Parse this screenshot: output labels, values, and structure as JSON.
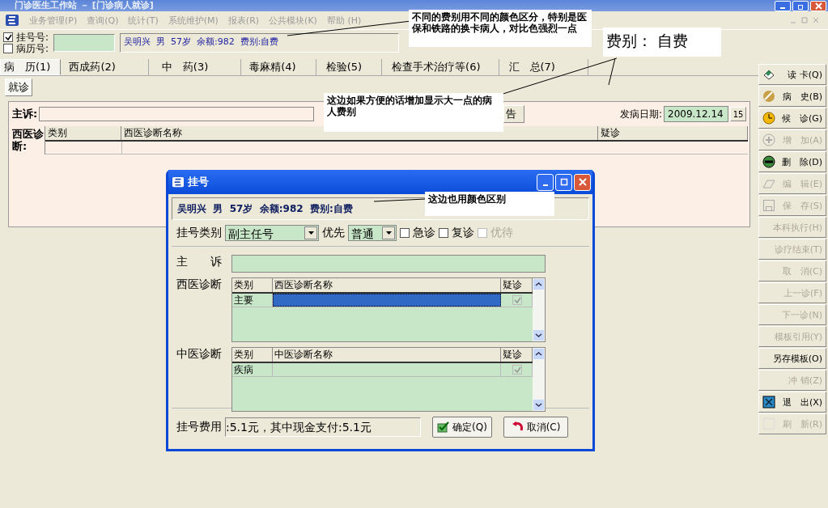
{
  "window": {
    "title": "门诊医生工作站 － [门诊病人就诊]"
  },
  "menu": [
    "业务管理(P)",
    "查询(Q)",
    "统计(T)",
    "系统维护(M)",
    "报表(R)",
    "公共模块(K)",
    "帮助 (H)"
  ],
  "lookup": {
    "options": [
      {
        "label": "挂号号:",
        "checked": true
      },
      {
        "label": "病历号:",
        "checked": false
      }
    ],
    "patient_info": "吴明兴  男  57岁  余额:982  费别:自费"
  },
  "tabs": [
    {
      "label": "病　历(1)",
      "selected": true
    },
    {
      "label": "西成药(2)",
      "selected": false
    },
    {
      "label": "中　药(3)",
      "selected": false
    },
    {
      "label": "毒麻精(4)",
      "selected": false
    },
    {
      "label": "检验(5)",
      "selected": false
    },
    {
      "label": "检查手术治疗等(6)",
      "selected": false
    },
    {
      "label": "汇　总(7)",
      "selected": false
    }
  ],
  "subtabs": [
    {
      "label": "就诊",
      "selected": true
    }
  ],
  "record": {
    "complaint_label": "主诉:",
    "button": "告",
    "onset_label": "发病日期:",
    "onset_date": "2009.12.14",
    "calendar": "15",
    "diagnosis_label": "西医诊断:",
    "columns": [
      "类别",
      "西医诊断名称",
      "疑诊"
    ]
  },
  "toolbar": [
    {
      "label": "读 卡(Q)",
      "kind": "card",
      "disabled": false
    },
    {
      "label": "病　史(B)",
      "kind": "history",
      "disabled": false
    },
    {
      "label": "候　诊(G)",
      "kind": "clock",
      "disabled": false
    },
    {
      "label": "增　加(A)",
      "kind": "add",
      "disabled": true
    },
    {
      "label": "删　除(D)",
      "kind": "remove",
      "disabled": false
    },
    {
      "label": "编　辑(E)",
      "kind": "edit",
      "disabled": true
    },
    {
      "label": "保　存(S)",
      "kind": "save",
      "disabled": true
    },
    {
      "label": "本科执行(H)",
      "kind": "text",
      "disabled": true
    },
    {
      "label": "诊疗结束(T)",
      "kind": "text",
      "disabled": true
    },
    {
      "label": "取　消(C)",
      "kind": "text",
      "disabled": true
    },
    {
      "label": "上一诊(F)",
      "kind": "text",
      "disabled": true
    },
    {
      "label": "下一诊(N)",
      "kind": "text",
      "disabled": true
    },
    {
      "label": "模板引用(Y)",
      "kind": "text",
      "disabled": true
    },
    {
      "label": "另存模板(O)",
      "kind": "text",
      "disabled": false
    },
    {
      "label": "冲 销(Z)",
      "kind": "text",
      "disabled": true
    },
    {
      "label": "退　出(X)",
      "kind": "exit",
      "disabled": false
    },
    {
      "label": "刷　新(R)",
      "kind": "refresh",
      "disabled": true
    }
  ],
  "dialog": {
    "title": "挂号",
    "patient_info": "吴明兴  男  57岁  余额:982  费别:自费",
    "type_label": "挂号类别",
    "type_value": "副主任号",
    "priority_label": "优先",
    "priority_value": "普通",
    "flags": [
      {
        "label": "急诊",
        "checked": false,
        "disabled": false
      },
      {
        "label": "复诊",
        "checked": false,
        "disabled": false
      },
      {
        "label": "优待",
        "checked": false,
        "disabled": true
      }
    ],
    "complaint_label": "主　　诉",
    "grids": [
      {
        "label": "西医诊断",
        "columns": [
          "类别",
          "西医诊断名称",
          "疑诊"
        ],
        "rows": [
          {
            "type": "主要",
            "suspected": true,
            "selected": true
          }
        ]
      },
      {
        "label": "中医诊断",
        "columns": [
          "类别",
          "中医诊断名称",
          "疑诊"
        ],
        "rows": [
          {
            "type": "疾病",
            "suspected": true,
            "selected": false
          }
        ]
      }
    ],
    "fee_label": "挂号费用",
    "fee_value": ":5.1元，其中现金支付:5.1元",
    "buttons": [
      {
        "label": "确定(Q)",
        "kind": "ok"
      },
      {
        "label": "取消(C)",
        "kind": "cancel"
      }
    ]
  },
  "annotations": [
    {
      "text": "不同的费别用不同的颜色区分，特别是医保和铁路的换卡病人，对比色强烈一点",
      "kind": "note"
    },
    {
      "text": "费别：  自费",
      "kind": "big"
    },
    {
      "text": "这边如果方便的话增加显示大一点的病人费别",
      "kind": "note"
    },
    {
      "text": "这边也用颜色区别",
      "kind": "note"
    }
  ]
}
